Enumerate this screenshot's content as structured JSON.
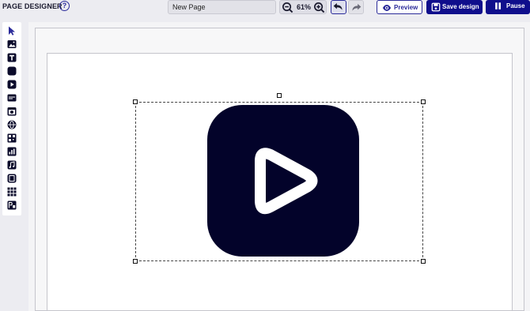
{
  "header": {
    "app_title": "PAGE DESIGNER",
    "help_label": "?",
    "page_name": "New Page",
    "zoom_level": "61%",
    "preview_label": "Preview",
    "save_label": "Save design",
    "pause_label": "Pause"
  },
  "toolbox": {
    "tools": [
      "select-tool",
      "image-tool",
      "text-tool",
      "shape-tool",
      "video-tool",
      "ticker-tool",
      "clock-tool",
      "web-tool",
      "qr-tool",
      "chart-tool",
      "audio-tool",
      "film-tool",
      "grid-tool",
      "powerpoint-tool"
    ]
  },
  "colors": {
    "accent": "#0f0e8c",
    "play_tile": "#03032a",
    "background": "#ececf1"
  }
}
